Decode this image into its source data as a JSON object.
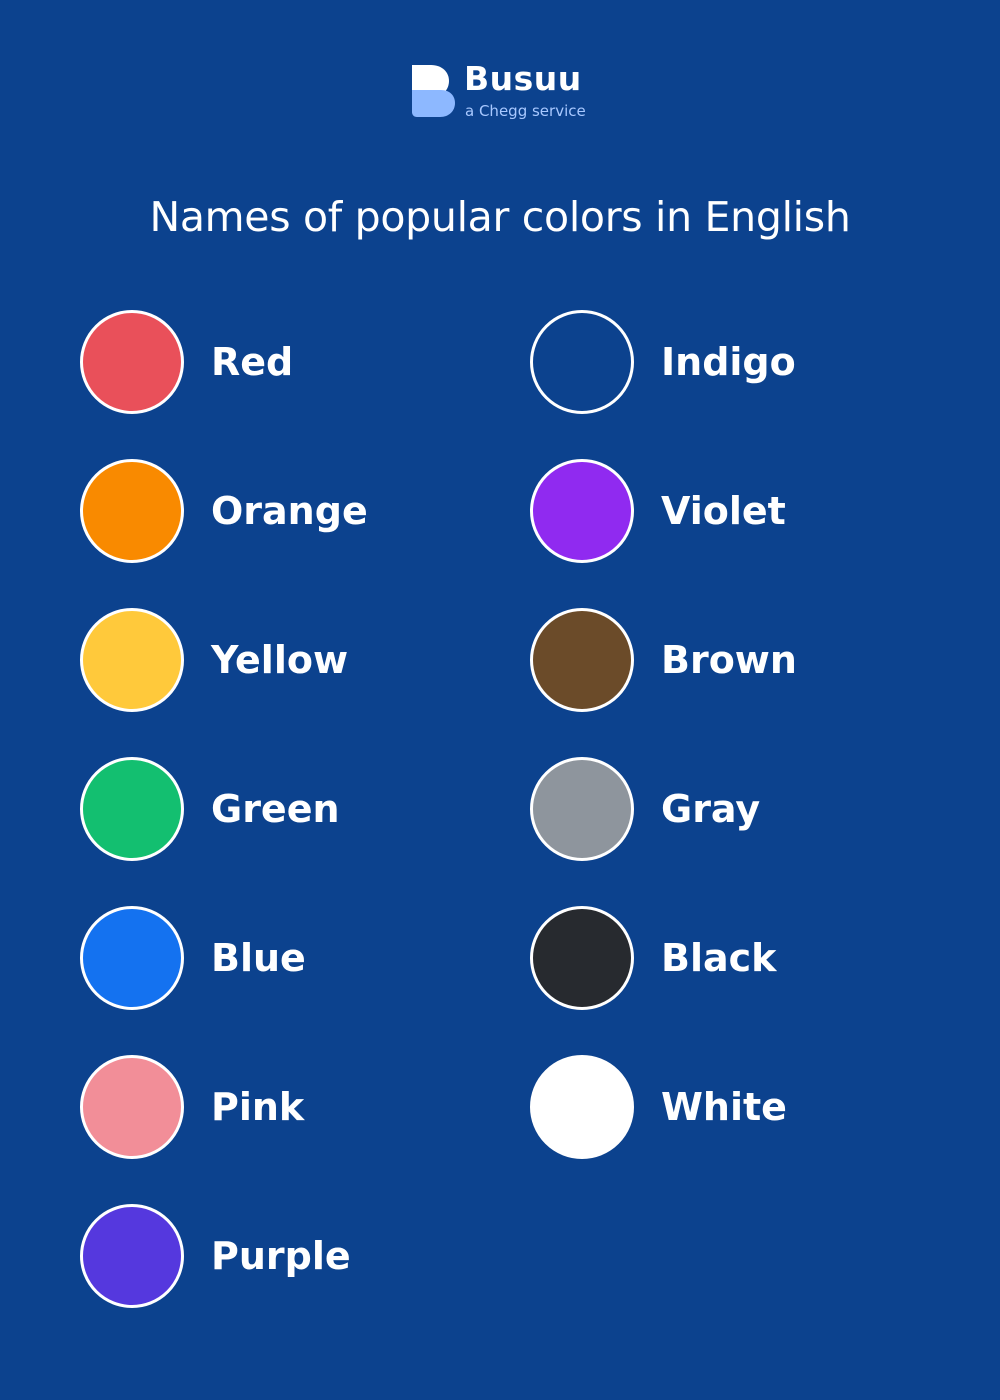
{
  "brand": {
    "name": "Busuu",
    "tagline": "a Chegg service",
    "mark_colors": {
      "top": "#ffffff",
      "bottom": "#8db8ff"
    }
  },
  "title": "Names of popular colors in English",
  "background_color": "#0c428e",
  "colors": {
    "left": [
      {
        "name": "Red",
        "hex": "#e9505a"
      },
      {
        "name": "Orange",
        "hex": "#f98a00"
      },
      {
        "name": "Yellow",
        "hex": "#ffc93b"
      },
      {
        "name": "Green",
        "hex": "#13bf70"
      },
      {
        "name": "Blue",
        "hex": "#1472f0"
      },
      {
        "name": "Pink",
        "hex": "#f28e98"
      },
      {
        "name": "Purple",
        "hex": "#5538de"
      }
    ],
    "right": [
      {
        "name": "Indigo",
        "hex": "#0c428e"
      },
      {
        "name": "Violet",
        "hex": "#902af0"
      },
      {
        "name": "Brown",
        "hex": "#6b4b29"
      },
      {
        "name": "Gray",
        "hex": "#8e959d"
      },
      {
        "name": "Black",
        "hex": "#272a2f"
      },
      {
        "name": "White",
        "hex": "#ffffff"
      }
    ]
  }
}
